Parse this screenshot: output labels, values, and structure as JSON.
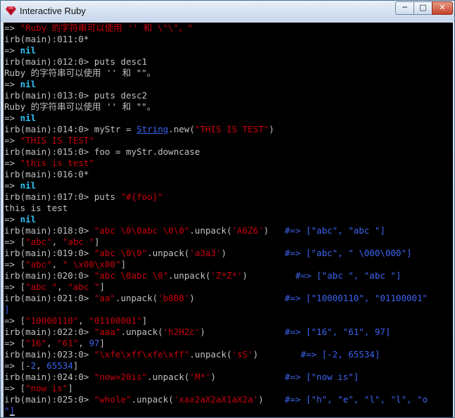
{
  "window": {
    "title": "Interactive Ruby",
    "icon": "ruby-gem-icon",
    "controls": {
      "minimize": "─",
      "maximize": "□",
      "close": "✕"
    }
  },
  "colors": {
    "background": "#000000",
    "text": "#c0c0c0",
    "string": "#c8000d",
    "nil": "#2fc0f0",
    "number": "#3c64f0",
    "comment": "#3c64f0"
  },
  "console": {
    "lines": [
      [
        [
          "arrow",
          "=> "
        ],
        [
          "str",
          "\"Ruby 的字符串可以使用 '' 和 \\\"\\\"。\""
        ]
      ],
      [
        [
          "plain",
          "irb(main):011:0*"
        ]
      ],
      [
        [
          "arrow",
          "=> "
        ],
        [
          "nil",
          "nil"
        ]
      ],
      [
        [
          "plain",
          "irb(main):012:0> puts desc1"
        ]
      ],
      [
        [
          "plain",
          "Ruby 的字符串可以使用 '' 和 \"\"。"
        ]
      ],
      [
        [
          "arrow",
          "=> "
        ],
        [
          "nil",
          "nil"
        ]
      ],
      [
        [
          "plain",
          "irb(main):013:0> puts desc2"
        ]
      ],
      [
        [
          "plain",
          "Ruby 的字符串可以使用 '' 和 \"\"。"
        ]
      ],
      [
        [
          "arrow",
          "=> "
        ],
        [
          "nil",
          "nil"
        ]
      ],
      [
        [
          "plain",
          "irb(main):014:0> myStr = "
        ],
        [
          "cls",
          "String"
        ],
        [
          "plain",
          ".new("
        ],
        [
          "str",
          "\"THIS IS TEST\""
        ],
        [
          "plain",
          ")"
        ]
      ],
      [
        [
          "arrow",
          "=> "
        ],
        [
          "str",
          "\"THIS IS TEST\""
        ]
      ],
      [
        [
          "plain",
          "irb(main):015:0> foo = myStr.downcase"
        ]
      ],
      [
        [
          "arrow",
          "=> "
        ],
        [
          "str",
          "\"this is test\""
        ]
      ],
      [
        [
          "plain",
          "irb(main):016:0*"
        ]
      ],
      [
        [
          "arrow",
          "=> "
        ],
        [
          "nil",
          "nil"
        ]
      ],
      [
        [
          "plain",
          "irb(main):017:0> puts "
        ],
        [
          "str",
          "\"#{foo}\""
        ]
      ],
      [
        [
          "plain",
          "this is test"
        ]
      ],
      [
        [
          "arrow",
          "=> "
        ],
        [
          "nil",
          "nil"
        ]
      ],
      [
        [
          "plain",
          "irb(main):018:0> "
        ],
        [
          "str",
          "\"abc \\0\\0abc \\0\\0\""
        ],
        [
          "plain",
          ".unpack("
        ],
        [
          "str",
          "'A6Z6'"
        ],
        [
          "plain",
          ")   "
        ],
        [
          "cmt",
          "#=> [\"abc\", \"abc \"]"
        ]
      ],
      [
        [
          "arrow",
          "=> ["
        ],
        [
          "str",
          "\"abc\""
        ],
        [
          "plain",
          ", "
        ],
        [
          "str",
          "\"abc \""
        ],
        [
          "plain",
          "]"
        ]
      ],
      [
        [
          "plain",
          "irb(main):019:0> "
        ],
        [
          "str",
          "\"abc \\0\\0\""
        ],
        [
          "plain",
          ".unpack("
        ],
        [
          "str",
          "'a3a3'"
        ],
        [
          "plain",
          ")           "
        ],
        [
          "cmt",
          "#=> [\"abc\", \" \\000\\000\"]"
        ]
      ],
      [
        [
          "arrow",
          "=> ["
        ],
        [
          "str",
          "\"abc\""
        ],
        [
          "plain",
          ", "
        ],
        [
          "str",
          "\" \\x00\\x00\""
        ],
        [
          "plain",
          "]"
        ]
      ],
      [
        [
          "plain",
          "irb(main):020:0> "
        ],
        [
          "str",
          "\"abc \\0abc \\0\""
        ],
        [
          "plain",
          ".unpack("
        ],
        [
          "str",
          "'Z*Z*'"
        ],
        [
          "plain",
          ")         "
        ],
        [
          "cmt",
          "#=> [\"abc \", \"abc \"]"
        ]
      ],
      [
        [
          "arrow",
          "=> ["
        ],
        [
          "str",
          "\"abc \""
        ],
        [
          "plain",
          ", "
        ],
        [
          "str",
          "\"abc \""
        ],
        [
          "plain",
          "]"
        ]
      ],
      [
        [
          "plain",
          "irb(main):021:0> "
        ],
        [
          "str",
          "\"aa\""
        ],
        [
          "plain",
          ".unpack("
        ],
        [
          "str",
          "'b8B8'"
        ],
        [
          "plain",
          ")                 "
        ],
        [
          "cmt",
          "#=> [\"10000110\", \"01100001\""
        ]
      ],
      [
        [
          "cmt",
          "]"
        ]
      ],
      [
        [
          "arrow",
          "=> ["
        ],
        [
          "str",
          "\"10000110\""
        ],
        [
          "plain",
          ", "
        ],
        [
          "str",
          "\"01100001\""
        ],
        [
          "plain",
          "]"
        ]
      ],
      [
        [
          "plain",
          "irb(main):022:0> "
        ],
        [
          "str",
          "\"aaa\""
        ],
        [
          "plain",
          ".unpack("
        ],
        [
          "str",
          "'h2H2c'"
        ],
        [
          "plain",
          ")               "
        ],
        [
          "cmt",
          "#=> [\"16\", \"61\", 97]"
        ]
      ],
      [
        [
          "arrow",
          "=> ["
        ],
        [
          "str",
          "\"16\""
        ],
        [
          "plain",
          ", "
        ],
        [
          "str",
          "\"61\""
        ],
        [
          "plain",
          ", "
        ],
        [
          "num",
          "97"
        ],
        [
          "plain",
          "]"
        ]
      ],
      [
        [
          "plain",
          "irb(main):023:0> "
        ],
        [
          "str",
          "\"\\xfe\\xff\\xfe\\xff\""
        ],
        [
          "plain",
          ".unpack("
        ],
        [
          "str",
          "'sS'"
        ],
        [
          "plain",
          ")        "
        ],
        [
          "cmt",
          "#=> [-2, 65534]"
        ]
      ],
      [
        [
          "arrow",
          "=> [-"
        ],
        [
          "num",
          "2"
        ],
        [
          "plain",
          ", "
        ],
        [
          "num",
          "65534"
        ],
        [
          "plain",
          "]"
        ]
      ],
      [
        [
          "plain",
          "irb(main):024:0> "
        ],
        [
          "str",
          "\"now=20is\""
        ],
        [
          "plain",
          ".unpack("
        ],
        [
          "str",
          "'M*'"
        ],
        [
          "plain",
          ")             "
        ],
        [
          "cmt",
          "#=> [\"now is\"]"
        ]
      ],
      [
        [
          "arrow",
          "=> ["
        ],
        [
          "str",
          "\"now is\""
        ],
        [
          "plain",
          "]"
        ]
      ],
      [
        [
          "plain",
          "irb(main):025:0> "
        ],
        [
          "str",
          "\"whole\""
        ],
        [
          "plain",
          ".unpack("
        ],
        [
          "str",
          "'xax2aX2aX1aX2a'"
        ],
        [
          "plain",
          ")    "
        ],
        [
          "cmt",
          "#=> [\"h\", \"e\", \"l\", \"l\", \"o"
        ]
      ],
      [
        [
          "cmt",
          "\"]"
        ]
      ]
    ]
  }
}
